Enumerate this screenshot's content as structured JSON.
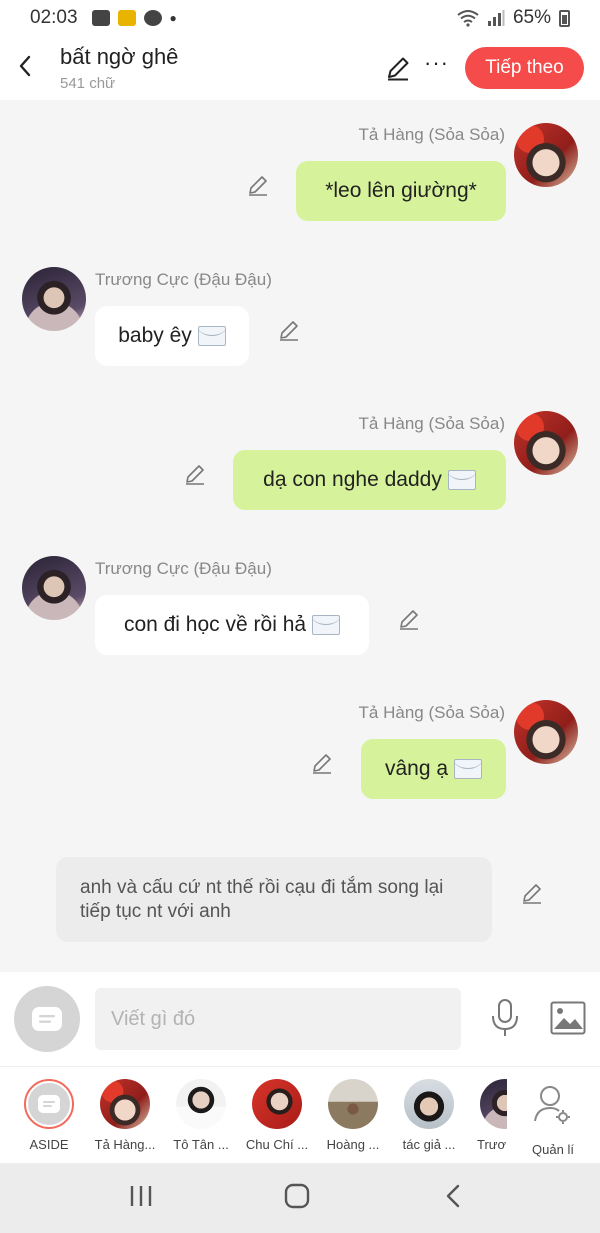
{
  "status_bar": {
    "time": "02:03",
    "battery": "65%"
  },
  "header": {
    "title": "bất ngờ ghê",
    "word_count": "541 chữ",
    "next_label": "Tiếp theo"
  },
  "messages": [
    {
      "side": "right",
      "sender": "Tả Hàng (Sỏa Sỏa)",
      "text": "*leo lên giường*",
      "has_envelope": false
    },
    {
      "side": "left",
      "sender": "Trương Cực (Đậu Đậu)",
      "text": "baby êy",
      "has_envelope": true
    },
    {
      "side": "right",
      "sender": "Tả Hàng (Sỏa Sỏa)",
      "text": "dạ con nghe daddy",
      "has_envelope": true
    },
    {
      "side": "left",
      "sender": "Trương Cực (Đậu Đậu)",
      "text": "con đi học về rồi hả",
      "has_envelope": true
    },
    {
      "side": "right",
      "sender": "Tả Hàng (Sỏa Sỏa)",
      "text": "vâng ạ",
      "has_envelope": true
    }
  ],
  "narration": "anh và cấu cứ nt thế rồi cạu đi tắm song lại tiếp tục nt với anh",
  "input": {
    "placeholder": "Viết gì đó"
  },
  "characters": [
    {
      "label": "ASIDE"
    },
    {
      "label": "Tả Hàng..."
    },
    {
      "label": "Tô Tân ..."
    },
    {
      "label": "Chu Chí ..."
    },
    {
      "label": "Hoàng ..."
    },
    {
      "label": "tác giả ..."
    },
    {
      "label": "Trươ"
    },
    {
      "label": "Quản lí"
    }
  ],
  "colors": {
    "accent": "#f54b4b",
    "outgoing_bubble": "#d6f29a",
    "incoming_bubble": "#ffffff"
  }
}
